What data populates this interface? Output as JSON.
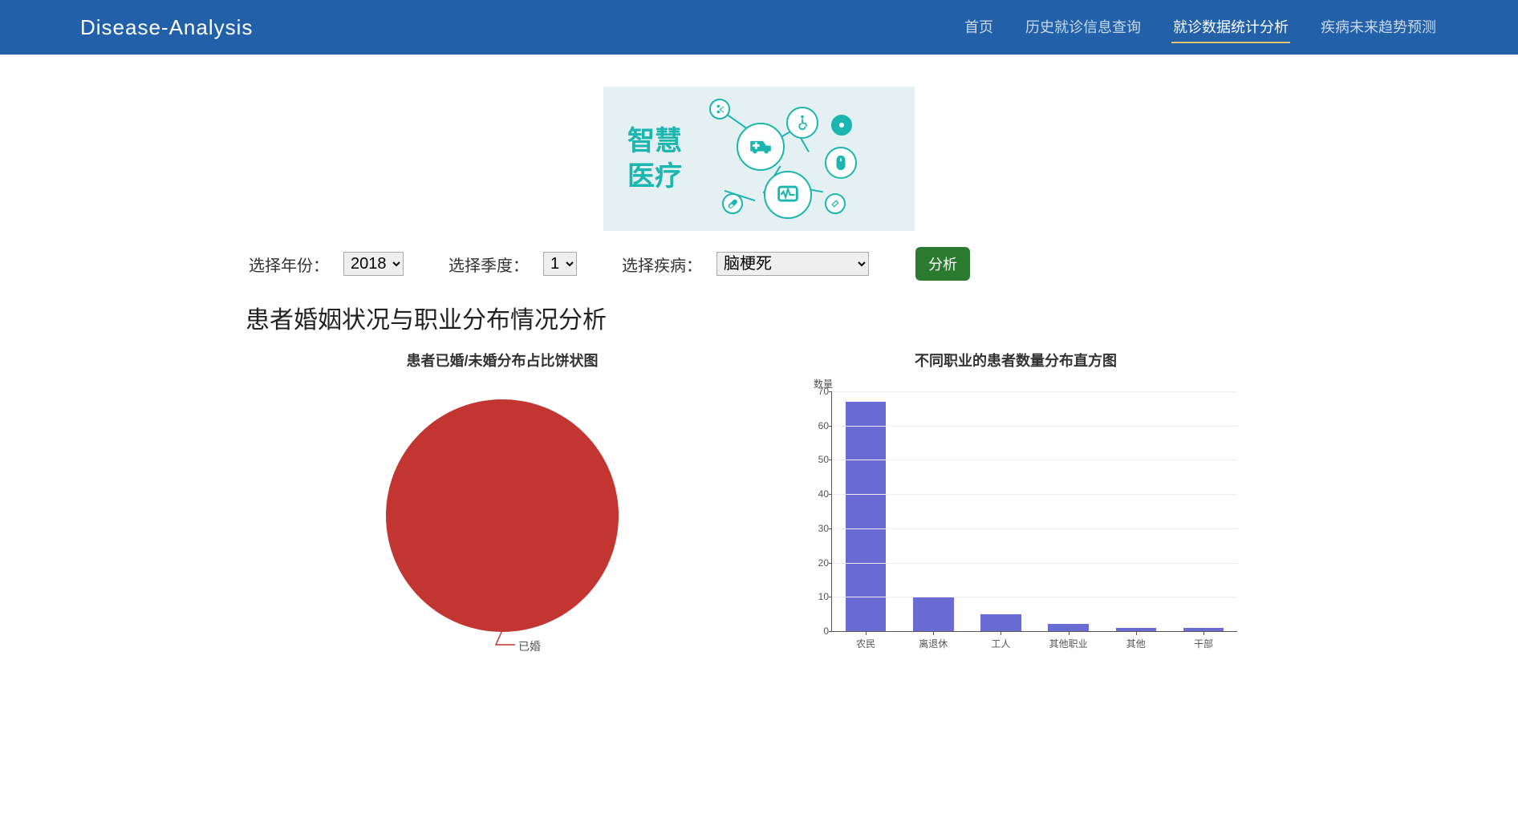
{
  "brand": "Disease-Analysis",
  "nav": {
    "items": [
      {
        "label": "首页",
        "active": false
      },
      {
        "label": "历史就诊信息查询",
        "active": false
      },
      {
        "label": "就诊数据统计分析",
        "active": true
      },
      {
        "label": "疾病未来趋势预测",
        "active": false
      }
    ]
  },
  "banner": {
    "line1": "智慧",
    "line2": "医疗"
  },
  "controls": {
    "year_label": "选择年份：",
    "year_value": "2018",
    "quarter_label": "选择季度：",
    "quarter_value": "1",
    "disease_label": "选择疾病：",
    "disease_value": "脑梗死",
    "analyze_label": "分析"
  },
  "section_title": "患者婚姻状况与职业分布情况分析",
  "pie": {
    "title": "患者已婚/未婚分布占比饼状图",
    "label_married": "已婚"
  },
  "bar": {
    "title": "不同职业的患者数量分布直方图",
    "y_axis_title": "数量"
  },
  "chart_data": [
    {
      "type": "pie",
      "title": "患者已婚/未婚分布占比饼状图",
      "categories": [
        "已婚"
      ],
      "values": [
        100
      ],
      "unit": "percent"
    },
    {
      "type": "bar",
      "title": "不同职业的患者数量分布直方图",
      "ylabel": "数量",
      "xlabel": "",
      "ylim": [
        0,
        70
      ],
      "yticks": [
        0,
        10,
        20,
        30,
        40,
        50,
        60,
        70
      ],
      "categories": [
        "农民",
        "离退休",
        "工人",
        "其他职业",
        "其他",
        "干部"
      ],
      "values": [
        67,
        10,
        5,
        2,
        1,
        1
      ]
    }
  ]
}
